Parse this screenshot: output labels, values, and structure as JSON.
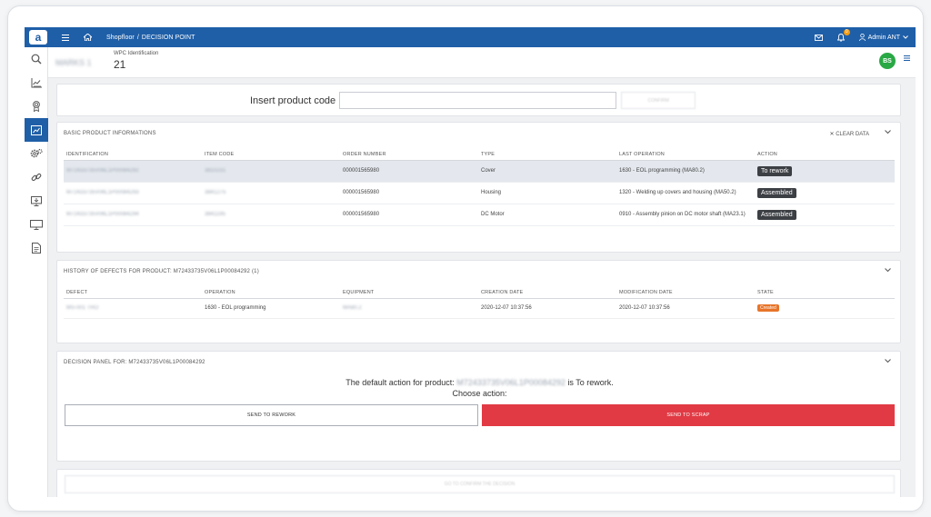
{
  "topbar": {
    "logo": "a",
    "menu_icon": "hamburger-icon",
    "home_icon": "home-icon",
    "breadcrumb": [
      "Shopfloor",
      "/",
      "Decision Point"
    ],
    "mail_icon": "mail-icon",
    "notifications_count": "0",
    "user_label": "Admin ANT",
    "colors": {
      "bar": "#1f5fa8"
    }
  },
  "sidebar": {
    "items": [
      {
        "icon": "search-icon"
      },
      {
        "icon": "chart-icon"
      },
      {
        "icon": "award-icon"
      },
      {
        "icon": "decision-point-icon",
        "active": true
      },
      {
        "icon": "settings-icon"
      },
      {
        "icon": "link-icon"
      },
      {
        "icon": "monitor-download-icon"
      },
      {
        "icon": "monitor-icon"
      },
      {
        "icon": "document-icon"
      }
    ]
  },
  "subheader": {
    "station": "MARKS 1",
    "wpc_label": "WPC Identification",
    "wpc_value": "21",
    "avatar": "BS"
  },
  "insert": {
    "label": "Insert product code",
    "input_value": "",
    "confirm_label": "CONFIRM"
  },
  "basic": {
    "title": "BASIC PRODUCT INFORMATIONS",
    "clear_label": "CLEAR DATA",
    "columns": [
      "IDENTIFICATION",
      "ITEM CODE",
      "ORDER NUMBER",
      "TYPE",
      "LAST OPERATION",
      "ACTION"
    ],
    "rows": [
      {
        "identification": "M72433735V06L1P00084292",
        "item_code": "3810231",
        "order": "000001565980",
        "type": "Cover",
        "last_op": "1630 - EOL programming (MA80.2)",
        "action": "To rework"
      },
      {
        "identification": "M72433735V06L1P00084293",
        "item_code": "3841275",
        "order": "000001565980",
        "type": "Housing",
        "last_op": "1320 - Welding up covers and housing (MA50.2)",
        "action": "Assembled"
      },
      {
        "identification": "M72433735V06L1P00084294",
        "item_code": "3841195",
        "order": "000001565980",
        "type": "DC Motor",
        "last_op": "0910 - Assembly pinion on DC motor shaft (MA23.1)",
        "action": "Assembled"
      }
    ]
  },
  "history": {
    "title": "HISTORY OF DEFECTS FOR PRODUCT: M72433735V06L1P00084292 (1)",
    "columns": [
      "DEFECT",
      "OPERATION",
      "EQUIPMENT",
      "CREATION DATE",
      "MODIFICATION DATE",
      "STATE"
    ],
    "rows": [
      {
        "defect": "MS-001 TRO",
        "operation": "1630 - EOL programming",
        "equipment": "MA80.2",
        "created": "2020-12-07 10:37:56",
        "modified": "2020-12-07 10:37:56",
        "state": "Created"
      }
    ],
    "colors": {
      "state": "#e8752a"
    }
  },
  "decision": {
    "title": "DECISION PANEL FOR: M72433735V06L1P00084292",
    "text_prefix": "The default action for product:",
    "product": "M72433735V06L1P00084292",
    "text_suffix": "is To rework.",
    "choose": "Choose action:",
    "rework_label": "SEND TO REWORK",
    "scrap_label": "SEND TO SCRAP",
    "colors": {
      "scrap": "#e13a44"
    }
  },
  "footer": {
    "confirm_label": "GO TO CONFIRM THE DECISION"
  }
}
